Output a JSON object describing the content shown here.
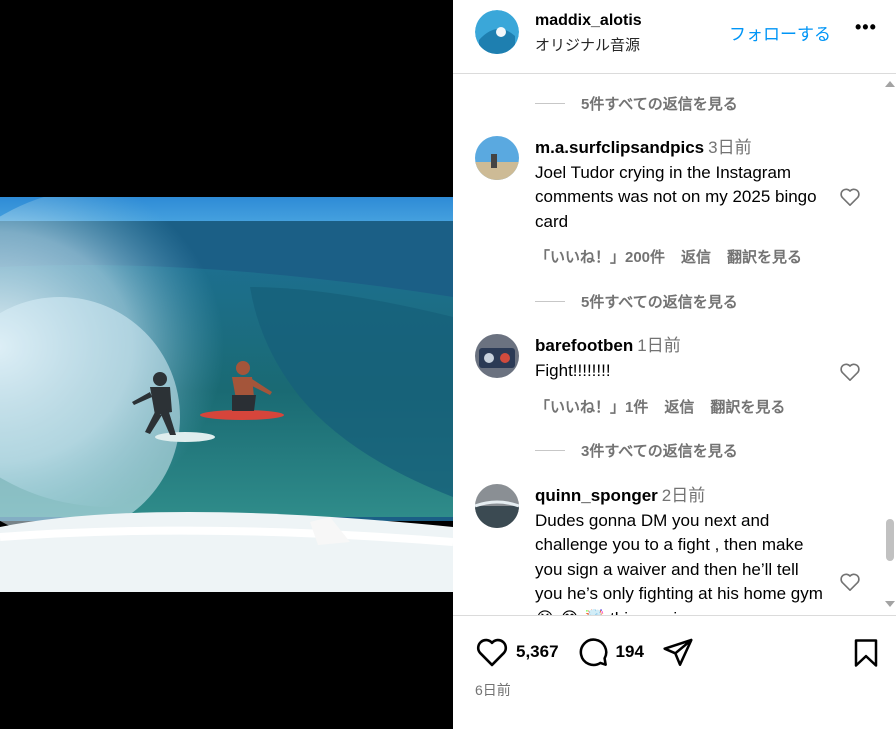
{
  "header": {
    "username": "maddix_alotis",
    "audio": "オリジナル音源",
    "follow_label": "フォローする",
    "more_label": "•••"
  },
  "comments": [
    {
      "replies_above": "5件すべての返信を見る",
      "user": "m.a.surfclipsandpics",
      "time": "3日前",
      "text": "Joel Tudor crying in the Instagram comments was not on my 2025 bingo card",
      "likes": "「いいね！」200件",
      "reply": "返信",
      "translate": "翻訳を見る"
    },
    {
      "replies_above": "5件すべての返信を見る",
      "user": "barefootben",
      "time": "1日前",
      "text": "Fight!!!!!!!!",
      "likes": "「いいね！」1件",
      "reply": "返信",
      "translate": "翻訳を見る"
    },
    {
      "replies_above": "3件すべての返信を見る",
      "user": "quinn_sponger",
      "time": "2日前",
      "text": "Dudes gonna DM you next and challenge you to a fight , then make you sign a waiver and then he’ll tell you he’s only fighting at his home gym 😭 😂 🤯 this guy is"
    }
  ],
  "footer": {
    "like_count": "5,367",
    "comment_count": "194",
    "posted": "6日前"
  },
  "colors": {
    "accent": "#0095f6",
    "muted": "#737373",
    "divider": "#dbdbdb"
  },
  "icons": [
    "heart-icon",
    "comment-icon",
    "share-icon",
    "bookmark-icon",
    "more-icon"
  ]
}
